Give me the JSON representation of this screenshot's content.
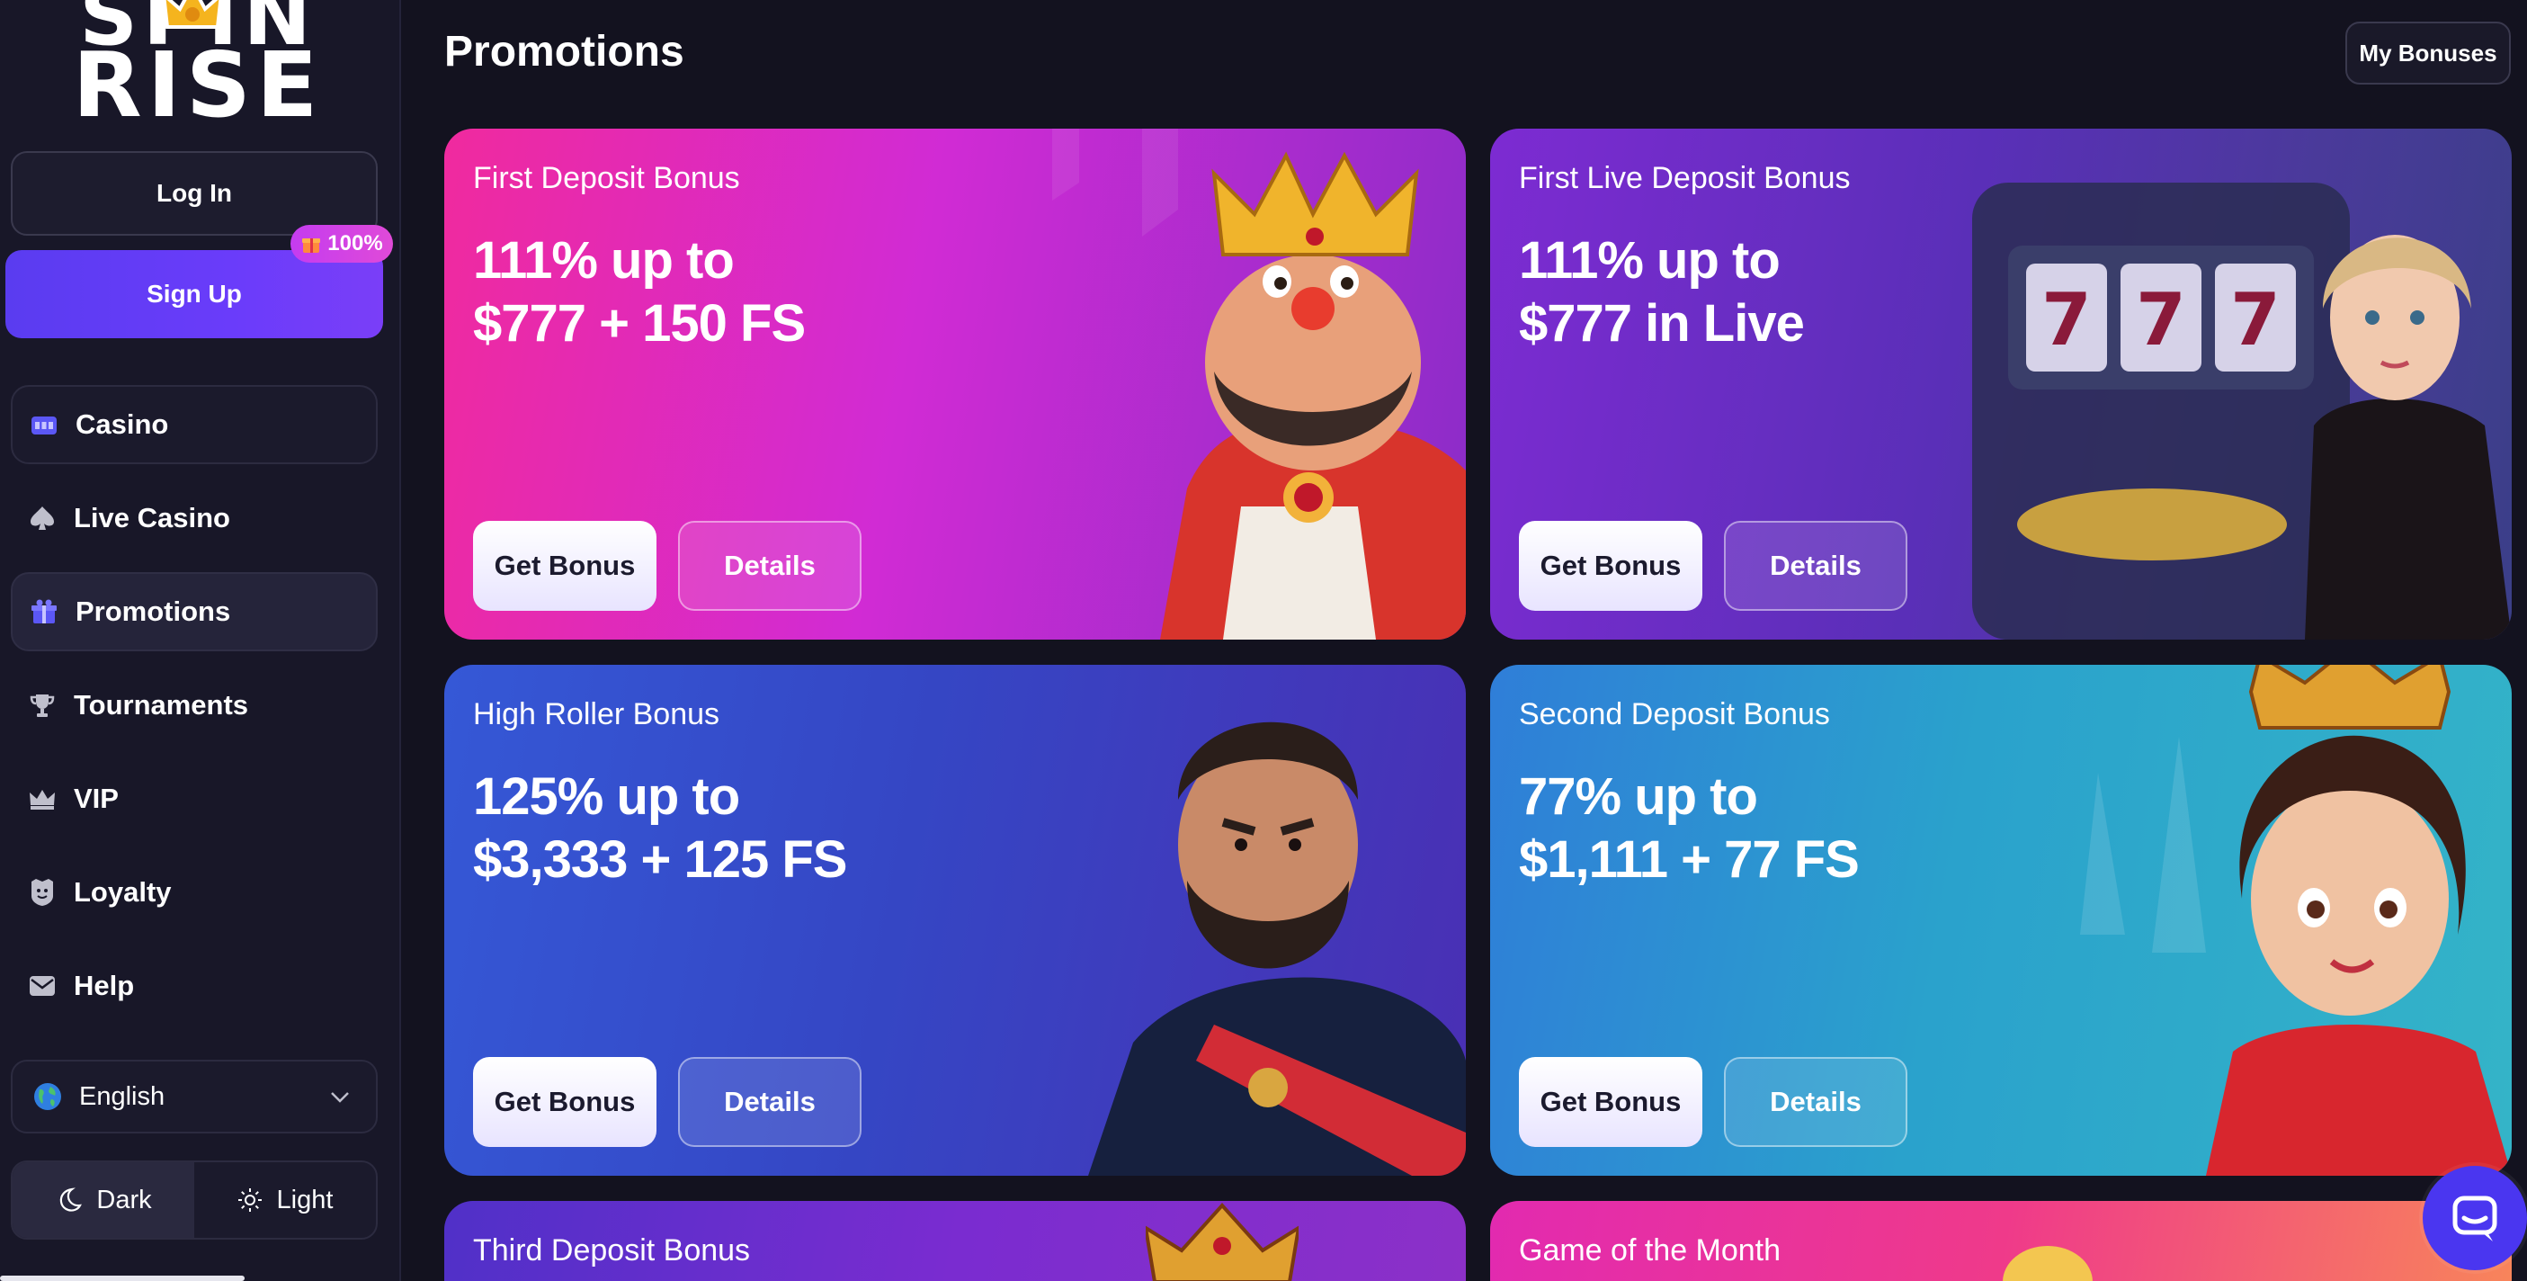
{
  "sidebar": {
    "logo_line1": "SPIN",
    "logo_line2": "RISE",
    "login_label": "Log In",
    "signup_label": "Sign Up",
    "signup_badge": "100%",
    "nav": [
      {
        "label": "Casino",
        "icon": "casino-icon"
      },
      {
        "label": "Live Casino",
        "icon": "spade-icon"
      },
      {
        "label": "Promotions",
        "icon": "gift-icon"
      },
      {
        "label": "Tournaments",
        "icon": "trophy-icon"
      },
      {
        "label": "VIP",
        "icon": "crown-icon"
      },
      {
        "label": "Loyalty",
        "icon": "shield-icon"
      },
      {
        "label": "Help",
        "icon": "mail-icon"
      }
    ],
    "language": "English",
    "theme": {
      "dark_label": "Dark",
      "light_label": "Light",
      "selected": "Dark"
    }
  },
  "header": {
    "title": "Promotions",
    "my_bonuses_label": "My Bonuses"
  },
  "cards": [
    {
      "subtitle": "First Deposit Bonus",
      "line1": "111% up to",
      "line2": "$777 + 150 FS",
      "get_label": "Get Bonus",
      "details_label": "Details"
    },
    {
      "subtitle": "First Live Deposit Bonus",
      "line1": "111% up to",
      "line2": "$777 in Live",
      "get_label": "Get Bonus",
      "details_label": "Details",
      "slot_text": "777"
    },
    {
      "subtitle": "High Roller Bonus",
      "line1": "125% up to",
      "line2": "$3,333 + 125 FS",
      "get_label": "Get Bonus",
      "details_label": "Details"
    },
    {
      "subtitle": "Second Deposit Bonus",
      "line1": "77% up to",
      "line2": "$1,111 + 77 FS",
      "get_label": "Get Bonus",
      "details_label": "Details"
    },
    {
      "subtitle": "Third Deposit Bonus"
    },
    {
      "subtitle": "Game of the Month"
    }
  ],
  "colors": {
    "background": "#13121f",
    "sidebar": "#181728",
    "accent": "#5a3cf0",
    "chat": "#4a36f0"
  }
}
